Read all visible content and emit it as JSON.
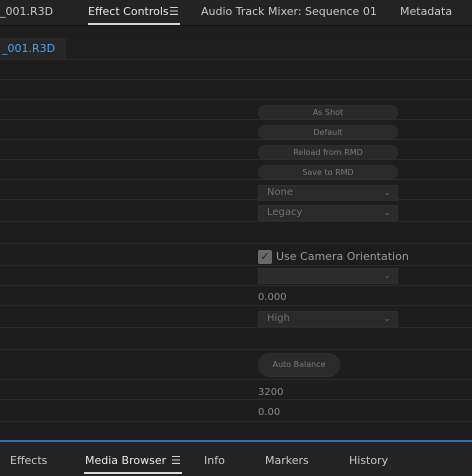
{
  "top_tabs": [
    {
      "label": "_001.R3D"
    },
    {
      "label": "Effect Controls",
      "active": true
    },
    {
      "label": "Audio Track Mixer: Sequence 01"
    },
    {
      "label": "Metadata"
    }
  ],
  "clip": {
    "name": "_001.R3D"
  },
  "controls": {
    "as_shot": "As Shot",
    "default": "Default",
    "reload_rmd": "Reload from RMD",
    "save_rmd": "Save to RMD",
    "dropdown_none": "None",
    "dropdown_legacy": "Legacy",
    "use_camera_orientation": "Use Camera Orientation",
    "use_camera_orientation_checked": true,
    "dropdown_empty": "",
    "value_0_000": "0.000",
    "dropdown_high": "High",
    "auto_balance": "Auto Balance",
    "value_3200": "3200",
    "value_0_00": "0.00"
  },
  "bottom_tabs": [
    {
      "label": "Effects"
    },
    {
      "label": "Media Browser",
      "active": true
    },
    {
      "label": "Info"
    },
    {
      "label": "Markers"
    },
    {
      "label": "History"
    }
  ],
  "colors": {
    "accent": "#2f6fb8",
    "clip_name": "#4aa3f0"
  },
  "icons": {
    "panel_menu": "hamburger-menu-icon",
    "chevron": "chevron-down-icon",
    "checkbox": "checkmark-icon"
  }
}
